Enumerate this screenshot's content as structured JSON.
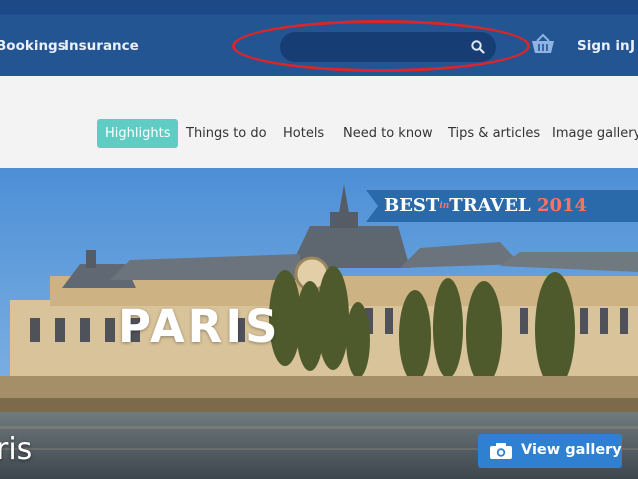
{
  "header": {
    "links": {
      "bookings": "Bookings",
      "insurance": "Insurance",
      "sign_in": "Sign in",
      "join": "J"
    },
    "search": {
      "value": "",
      "placeholder": ""
    },
    "icons": {
      "search": "search-icon",
      "basket": "basket-icon"
    },
    "colors": {
      "bar": "#235593",
      "search_bg": "#173e74",
      "ring": "#d8262b"
    }
  },
  "subnav": {
    "tabs": [
      {
        "label": "Highlights",
        "active": true
      },
      {
        "label": "Things to do"
      },
      {
        "label": "Hotels"
      },
      {
        "label": "Need to know"
      },
      {
        "label": "Tips & articles"
      },
      {
        "label": "Image gallery"
      }
    ],
    "colors": {
      "active": "#5fcdc4"
    }
  },
  "hero": {
    "logo": "PARIS",
    "banner": {
      "best": "BEST",
      "in": "in",
      "travel": "TRAVEL",
      "year": "2014"
    },
    "caption": "ris",
    "gallery_button": {
      "label": "View gallery",
      "icon": "camera-icon"
    },
    "colors": {
      "button": "#2f80d0",
      "banner": "#2b6aaa",
      "year": "#ff7262"
    }
  }
}
